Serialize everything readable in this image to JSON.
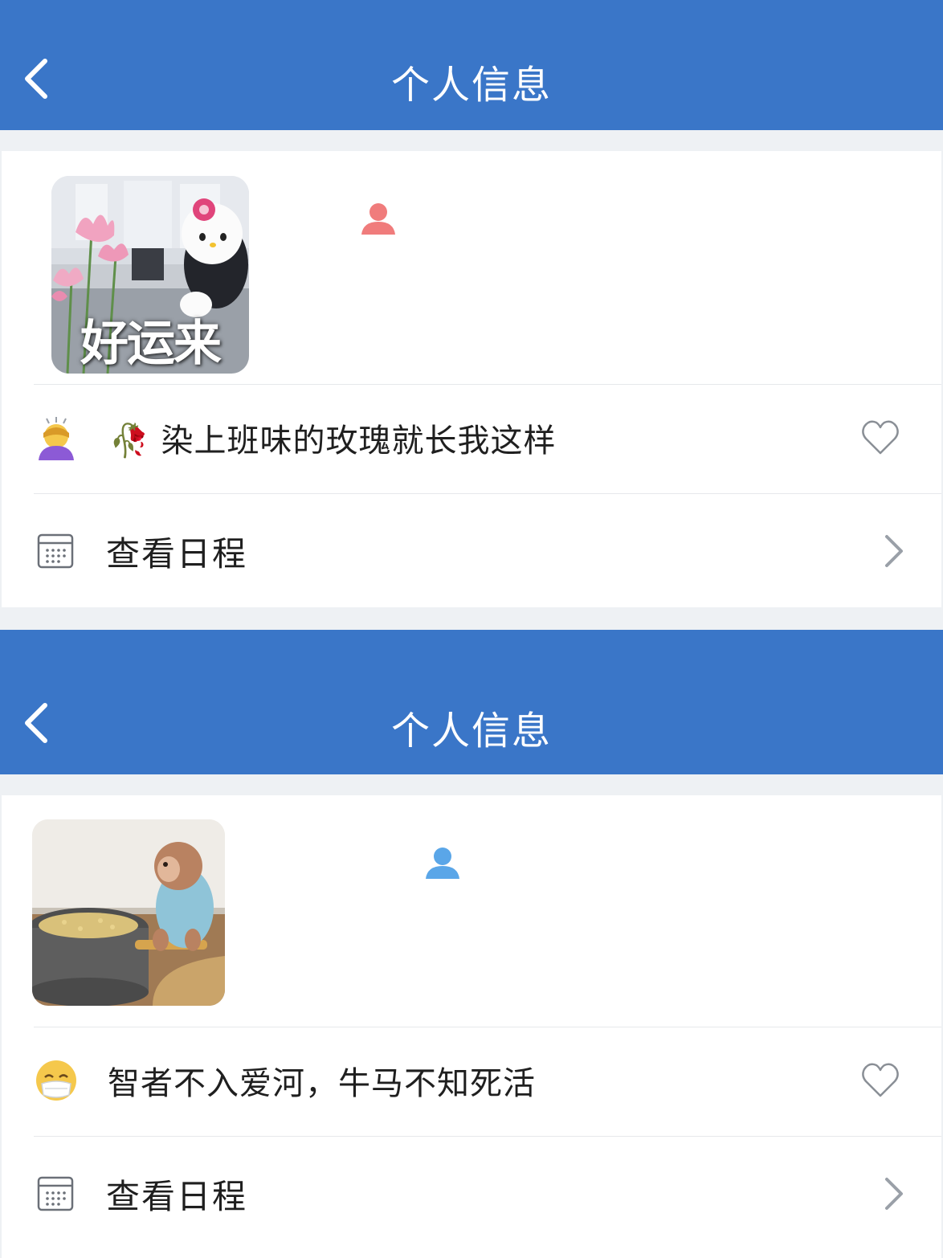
{
  "profiles": [
    {
      "header": {
        "title": "个人信息"
      },
      "avatar": {
        "caption": "好运来",
        "theme": "hello-kitty-lotus-office"
      },
      "gender_icon": {
        "name": "person-icon",
        "color": "#f07c7c"
      },
      "status": {
        "emoji": "woman-bowing-emoji",
        "emoji_char": "🙇‍♀️",
        "text": "🥀 染上班味的玫瑰就长我这样"
      },
      "schedule": {
        "label": "查看日程"
      }
    },
    {
      "header": {
        "title": "个人信息"
      },
      "avatar": {
        "caption": "",
        "theme": "monkey-at-millstone"
      },
      "gender_icon": {
        "name": "person-icon",
        "color": "#5aa6e8"
      },
      "status": {
        "emoji": "face-with-mask-emoji",
        "emoji_char": "😷",
        "text": "智者不入爱河，牛马不知死活"
      },
      "schedule": {
        "label": "查看日程"
      }
    }
  ],
  "colors": {
    "header_bg": "#3a76c8",
    "page_bg": "#eef1f4",
    "card_bg": "#ffffff",
    "text": "#1f1f1f",
    "icon_gray": "#8a8f96"
  }
}
